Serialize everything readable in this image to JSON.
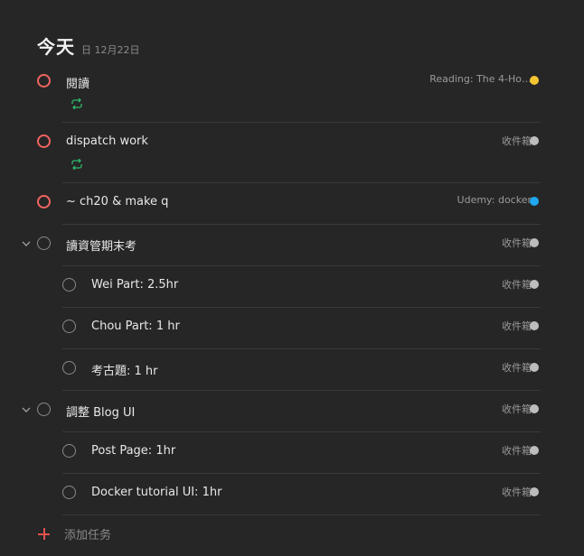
{
  "header": {
    "title": "今天",
    "date": "日 12月22日"
  },
  "colors": {
    "yellow": "#f5c431",
    "gray": "#bdbdbd",
    "blue": "#1fa8f0",
    "red": "#f06560",
    "repeat_green": "#2fb86a"
  },
  "tasks": [
    {
      "label": "閱讀",
      "project": "Reading: The 4-Ho…",
      "project_color": "#f5c431",
      "repeat_icon": "repeat-icon"
    },
    {
      "label": "dispatch work",
      "project": "收件箱",
      "project_color": "#bdbdbd",
      "repeat_icon": "repeat-icon"
    },
    {
      "label": "~ ch20 & make q",
      "project": "Udemy: docker",
      "project_color": "#1fa8f0"
    },
    {
      "label": "讀資管期末考",
      "project": "收件箱",
      "project_color": "#bdbdbd"
    },
    {
      "label": "Wei Part: 2.5hr",
      "project": "收件箱",
      "project_color": "#bdbdbd"
    },
    {
      "label": "Chou Part: 1 hr",
      "project": "收件箱",
      "project_color": "#bdbdbd"
    },
    {
      "label": "考古題: 1 hr",
      "project": "收件箱",
      "project_color": "#bdbdbd"
    },
    {
      "label": "調整 Blog UI",
      "project": "收件箱",
      "project_color": "#bdbdbd"
    },
    {
      "label": "Post Page: 1hr",
      "project": "收件箱",
      "project_color": "#bdbdbd"
    },
    {
      "label": "Docker tutorial UI: 1hr",
      "project": "收件箱",
      "project_color": "#bdbdbd"
    }
  ],
  "add_task": {
    "label": "添加任务"
  }
}
